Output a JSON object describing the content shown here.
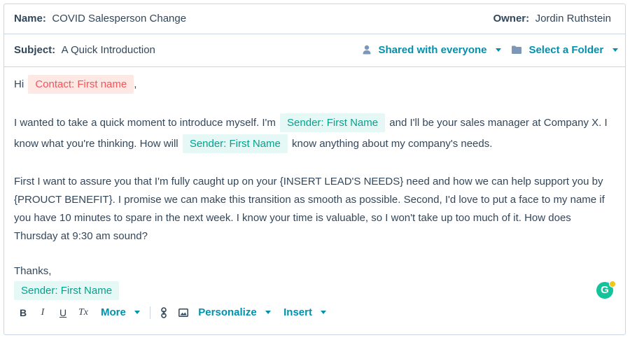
{
  "header": {
    "name_label": "Name:",
    "name_value": "COVID Salesperson Change",
    "owner_label": "Owner:",
    "owner_value": "Jordin Ruthstein"
  },
  "subject": {
    "label": "Subject:",
    "value": "A Quick Introduction",
    "shared_label": "Shared with everyone",
    "folder_label": "Select a Folder"
  },
  "body": {
    "greeting": "Hi",
    "contact_token": "Contact: First name",
    "greeting_comma": ",",
    "p1_part1": "I wanted to take a quick moment to introduce myself. I'm",
    "sender_token": "Sender: First Name",
    "p1_part2": "and I'll be your sales manager at Company X. I",
    "p1_part3": "know what you're thinking. How will",
    "p1_part4": "know anything about my company's needs.",
    "p2_line1": "First I want to assure you that I'm fully caught up on your {INSERT LEAD'S NEEDS} need and how we can help support you by",
    "p2_line2": "{PROUCT BENEFIT}. I promise we can make this transition as smooth as possible. Second, I'd love to put a face to my name if",
    "p2_line3": "you have 10 minutes to spare in the next week. I know your time is valuable, so I won't take up too much of it. How does",
    "p2_line4": "Thursday at 9:30 am sound?",
    "thanks": "Thanks,"
  },
  "toolbar": {
    "bold": "B",
    "italic": "I",
    "underline": "U",
    "clear_format": "Tx",
    "more": "More",
    "personalize": "Personalize",
    "insert": "Insert"
  },
  "grammarly": {
    "letter": "G"
  },
  "colors": {
    "accent": "#0091ae",
    "contact_token_bg": "#fde8e4",
    "contact_token_text": "#f2545b",
    "sender_token_bg": "#e5f8f6",
    "sender_token_text": "#00a38d",
    "border": "#cbd6e2"
  }
}
